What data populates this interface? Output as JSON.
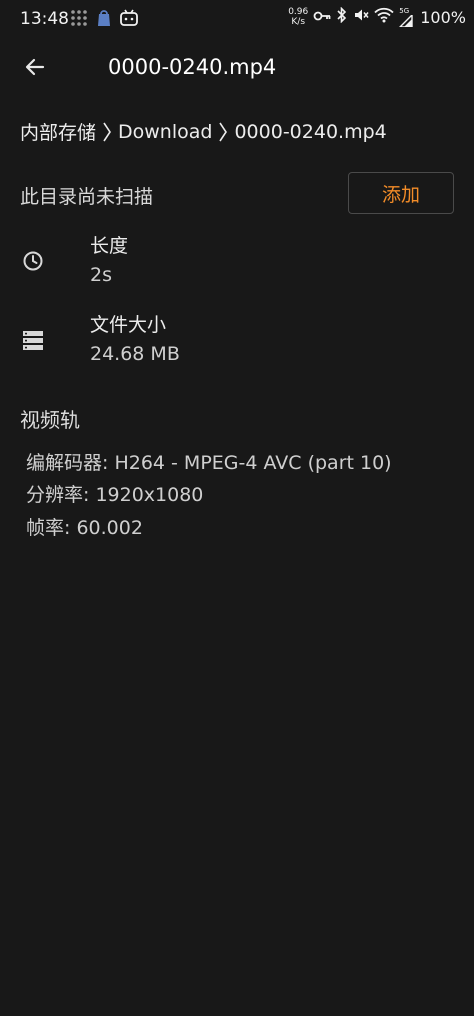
{
  "status_bar": {
    "time": "13:48",
    "speed_value": "0.96",
    "speed_unit": "K/s",
    "network_label": "5G",
    "battery": "100%"
  },
  "app_bar": {
    "title": "0000-0240.mp4"
  },
  "breadcrumb": {
    "items": [
      "内部存储",
      "Download",
      "0000-0240.mp4"
    ]
  },
  "scan": {
    "message": "此目录尚未扫描",
    "add_label": "添加",
    "accent_color": "#f28c28"
  },
  "info": {
    "duration_label": "长度",
    "duration_value": "2s",
    "size_label": "文件大小",
    "size_value": "24.68 MB"
  },
  "video_track": {
    "title": "视频轨",
    "lines": [
      "编解码器: H264 - MPEG-4 AVC (part 10)",
      "分辨率: 1920x1080",
      "帧率: 60.002"
    ]
  }
}
